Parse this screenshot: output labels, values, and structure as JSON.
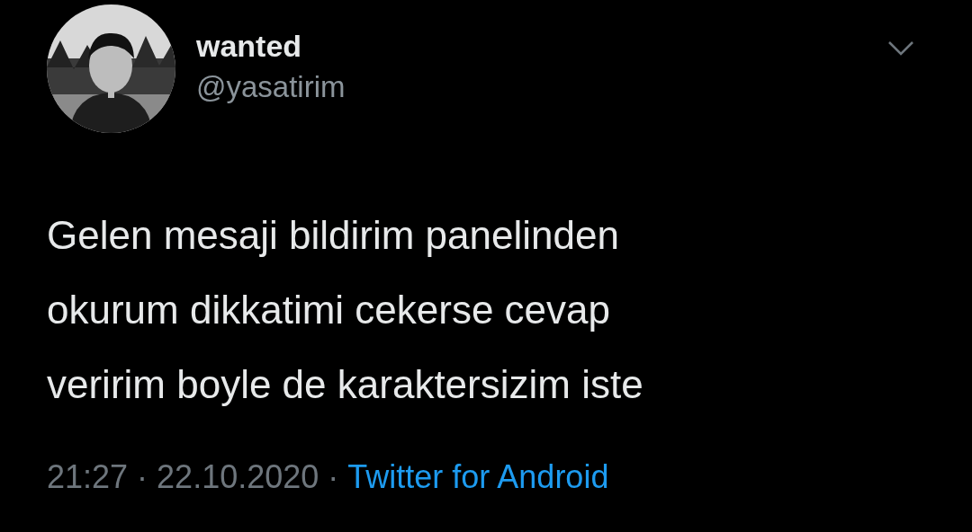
{
  "tweet": {
    "name": "wanted",
    "handle": "@yasatirim",
    "text_lines": [
      "Gelen mesaji bildirim panelinden",
      "okurum dikkatimi cekerse cevap",
      "veririm boyle de karaktersizim iste"
    ],
    "footer": [
      {
        "kind": "meta",
        "text": "21:27"
      },
      {
        "kind": "dot",
        "text": "·"
      },
      {
        "kind": "meta",
        "text": "22.10.2020"
      },
      {
        "kind": "dot",
        "text": "·"
      },
      {
        "kind": "link",
        "text": "Twitter for Android"
      }
    ]
  }
}
